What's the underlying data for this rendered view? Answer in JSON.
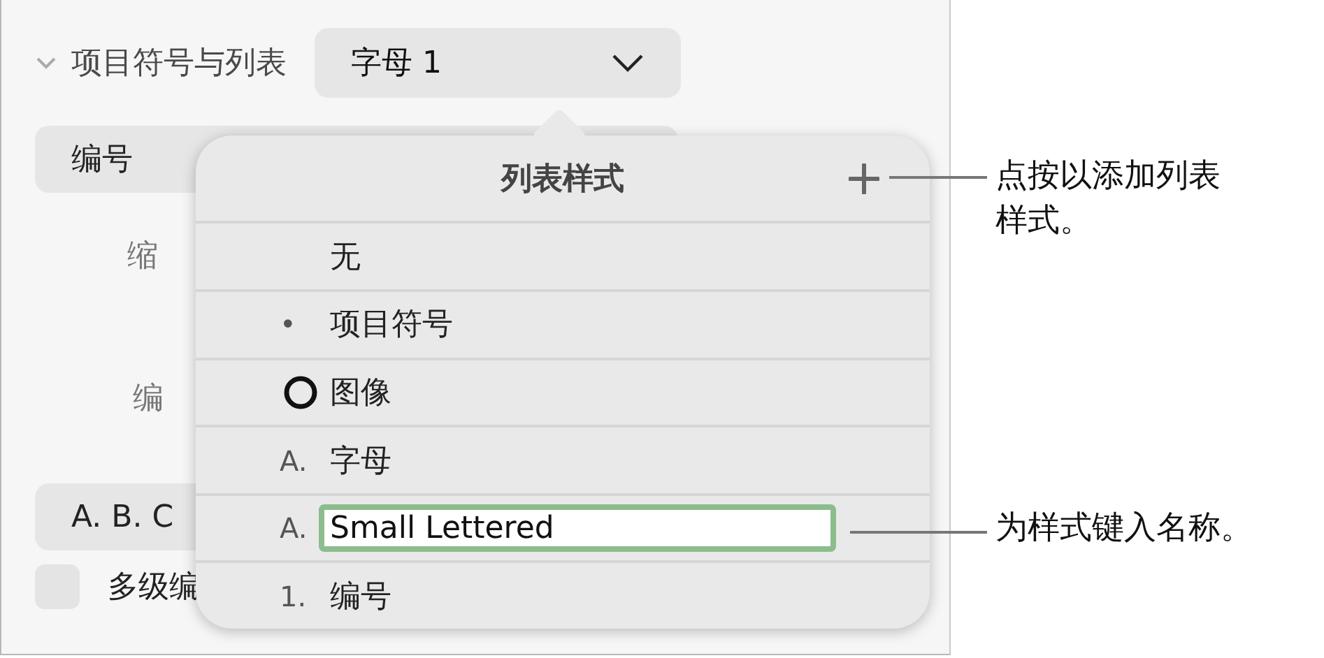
{
  "panel": {
    "section_title": "项目符号与列表",
    "expanded": true,
    "style_popup": "字母 1",
    "type_field": "编号",
    "indent_label": "缩",
    "number_label": "编",
    "format_field": "A. B. C",
    "multilevel": {
      "label": "多级编",
      "checked": false
    }
  },
  "popover": {
    "title": "列表样式",
    "styles": [
      {
        "kind": "text",
        "name": "无"
      },
      {
        "kind": "text",
        "marker": "•",
        "name": "项目符号"
      },
      {
        "kind": "image",
        "name": "图像"
      },
      {
        "kind": "text",
        "marker": "A.",
        "name": "字母"
      },
      {
        "kind": "editing",
        "marker": "A.",
        "name": "Small Lettered"
      },
      {
        "kind": "text",
        "marker": "1.",
        "name": "编号"
      }
    ]
  },
  "callouts": [
    "点按以添加列表样式。",
    "为样式键入名称。"
  ]
}
